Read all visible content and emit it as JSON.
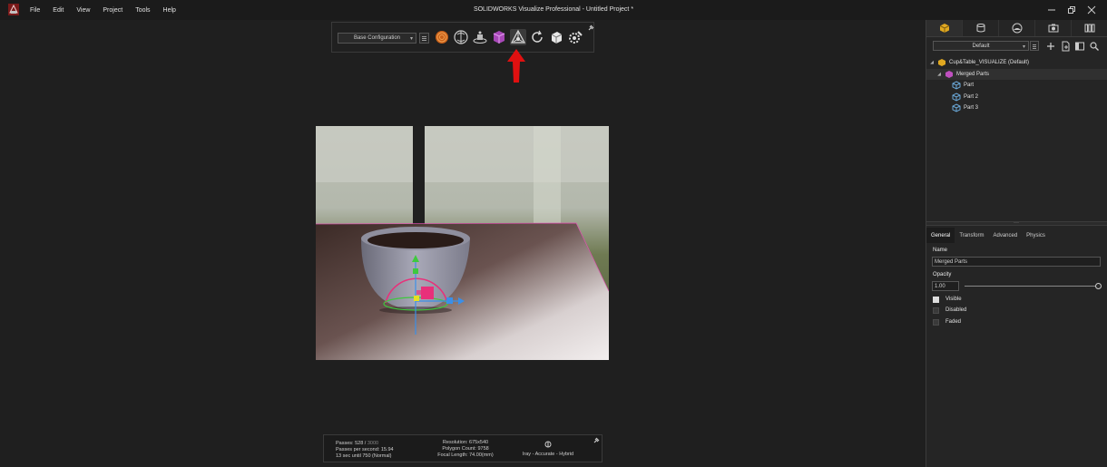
{
  "window": {
    "title": "SOLIDWORKS Visualize Professional - Untitled Project *"
  },
  "menu": [
    "File",
    "Edit",
    "View",
    "Project",
    "Tools",
    "Help"
  ],
  "toolbar": {
    "configuration": "Base Configuration",
    "tools": [
      "material-icon",
      "appearance-icon",
      "scene-icon",
      "part-icon",
      "transform-gizmo-icon",
      "reset-icon",
      "cube-icon",
      "settings-icon"
    ],
    "active_tool": "transform-gizmo-icon"
  },
  "stats": {
    "passes_label": "Passes: 528 /",
    "passes_total": "3000",
    "passes_per_second": "Passes per second: 15.94",
    "time_left": "13 sec until 750 (Normal)",
    "resolution": "Resolution: 675x540",
    "polygon_count": "Polygon Count: 9758",
    "focal_length": "Focal Length: 74.00(mm)",
    "render_mode": "Iray - Accurate - Hybrid"
  },
  "right_panel": {
    "tabs": [
      "models-icon",
      "cameras-icon",
      "environment-icon",
      "images-icon",
      "libraries-icon"
    ],
    "active_tab": 0,
    "grouping": "Default",
    "tree": [
      {
        "label": "Cup&Table_VISUALIZE (Default)",
        "level": 0
      },
      {
        "label": "Merged Parts",
        "level": 1
      },
      {
        "label": "Part",
        "level": 2
      },
      {
        "label": "Part 2",
        "level": 2
      },
      {
        "label": "Part 3",
        "level": 2
      }
    ],
    "property_tabs": [
      "General",
      "Transform",
      "Advanced",
      "Physics"
    ],
    "active_property_tab": 0,
    "name_label": "Name",
    "name_value": "Merged Parts",
    "opacity_label": "Opacity",
    "opacity_value": "1.00",
    "checkboxes": [
      {
        "label": "Visible",
        "checked": true
      },
      {
        "label": "Disabled",
        "checked": false
      },
      {
        "label": "Faded",
        "checked": false
      }
    ]
  },
  "colors": {
    "accent_red": "#e01010",
    "gizmo_green": "#3ec93e",
    "gizmo_blue": "#3a8fe8",
    "gizmo_pink": "#e8307a",
    "part_icon": "#c050c0"
  }
}
